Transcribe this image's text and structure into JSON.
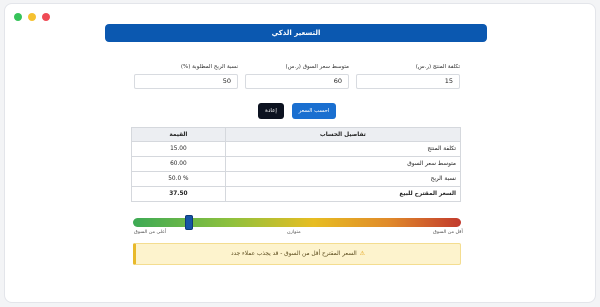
{
  "title": "التسعير الذكي",
  "fields": [
    {
      "label": "تكلفة المنتج (ر.س)",
      "value": "15"
    },
    {
      "label": "متوسط سعر السوق (ر.س)",
      "value": "60"
    },
    {
      "label": "نسبة الربح المطلوبة (%)",
      "value": "50"
    }
  ],
  "buttons": {
    "calculate": "احسب السعر",
    "reset": "إعادة"
  },
  "table": {
    "headers": {
      "details": "تفاصيل الحساب",
      "value": "القيمة"
    },
    "rows": [
      {
        "label": "تكلفة المنتج",
        "value": "15.00"
      },
      {
        "label": "متوسط سعر السوق",
        "value": "60.00"
      },
      {
        "label": "نسبة الربح",
        "value": "50.0 %"
      }
    ],
    "total": {
      "label": "السعر المقترح للبيع",
      "value": "37.50"
    }
  },
  "gauge": {
    "label_left": "أعلى من السوق",
    "label_center": "متوازن",
    "label_right": "أقل من السوق",
    "marker_fraction": 0.17
  },
  "alert": {
    "icon": "warning-icon",
    "text": "السعر المقترح أقل من السوق - قد يجذب عملاء جدد"
  },
  "colors": {
    "header": "#0b58b0",
    "calculate_button": "#1a6fd0",
    "reset_button": "#0c1220",
    "alert_bg": "#fdf3cd"
  }
}
